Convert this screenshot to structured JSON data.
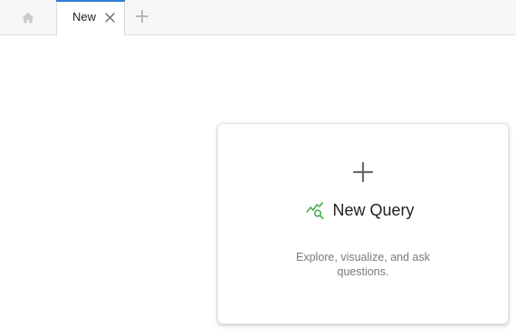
{
  "tabbar": {
    "home_icon": "home-icon",
    "tabs": [
      {
        "label": "New",
        "active": true,
        "close_icon": "close-icon"
      }
    ],
    "add_tab_icon": "plus-icon",
    "accent_color": "#2f7ed8"
  },
  "card": {
    "plus_icon": "plus-icon",
    "title_icon": "chart-search-icon",
    "title_icon_color": "#4caf50",
    "title": "New Query",
    "description": "Explore, visualize, and ask questions."
  }
}
